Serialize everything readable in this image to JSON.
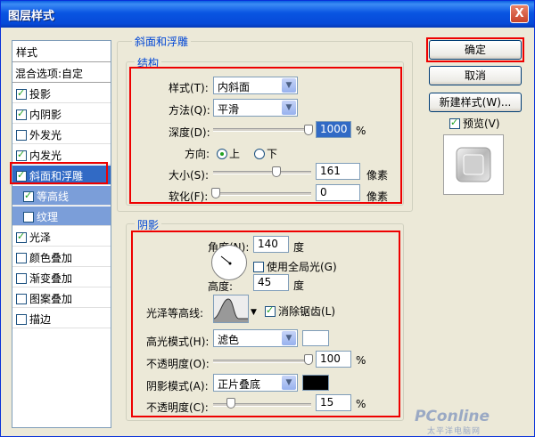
{
  "window": {
    "title": "图层样式",
    "close_glyph": "X"
  },
  "styles_panel": {
    "header": "样式",
    "blending": "混合选项:自定",
    "items": [
      {
        "label": "投影",
        "checked": true
      },
      {
        "label": "内阴影",
        "checked": true
      },
      {
        "label": "外发光",
        "checked": false
      },
      {
        "label": "内发光",
        "checked": true
      },
      {
        "label": "斜面和浮雕",
        "checked": true,
        "selected": true
      },
      {
        "label": "等高线",
        "checked": true,
        "sub": true
      },
      {
        "label": "纹理",
        "checked": false,
        "sub": true
      },
      {
        "label": "光泽",
        "checked": true
      },
      {
        "label": "颜色叠加",
        "checked": false
      },
      {
        "label": "渐变叠加",
        "checked": false
      },
      {
        "label": "图案叠加",
        "checked": false
      },
      {
        "label": "描边",
        "checked": false
      }
    ]
  },
  "bevel": {
    "title": "斜面和浮雕",
    "structure_title": "结构",
    "style_label": "样式(T):",
    "style_value": "内斜面",
    "technique_label": "方法(Q):",
    "technique_value": "平滑",
    "depth_label": "深度(D):",
    "depth_value": "1000",
    "depth_unit": "%",
    "direction_label": "方向:",
    "direction_up": "上",
    "direction_down": "下",
    "size_label": "大小(S):",
    "size_value": "161",
    "size_unit": "像素",
    "soften_label": "软化(F):",
    "soften_value": "0",
    "soften_unit": "像素"
  },
  "shading": {
    "title": "阴影",
    "angle_label": "角度(N):",
    "angle_value": "140",
    "angle_unit": "度",
    "global_light_label": "使用全局光(G)",
    "altitude_label": "高度:",
    "altitude_value": "45",
    "altitude_unit": "度",
    "gloss_contour_label": "光泽等高线:",
    "anti_alias_label": "消除锯齿(L)",
    "highlight_mode_label": "高光模式(H):",
    "highlight_mode_value": "滤色",
    "highlight_color": "#FFFFFF",
    "highlight_opacity_label": "不透明度(O):",
    "highlight_opacity_value": "100",
    "highlight_opacity_unit": "%",
    "shadow_mode_label": "阴影模式(A):",
    "shadow_mode_value": "正片叠底",
    "shadow_color": "#000000",
    "shadow_opacity_label": "不透明度(C):",
    "shadow_opacity_value": "15",
    "shadow_opacity_unit": "%"
  },
  "buttons": {
    "ok": "确定",
    "cancel": "取消",
    "new_style": "新建样式(W)...",
    "preview": "预览(V)"
  },
  "watermark": {
    "brand": "PConline",
    "sub": "太平洋电脑网"
  }
}
